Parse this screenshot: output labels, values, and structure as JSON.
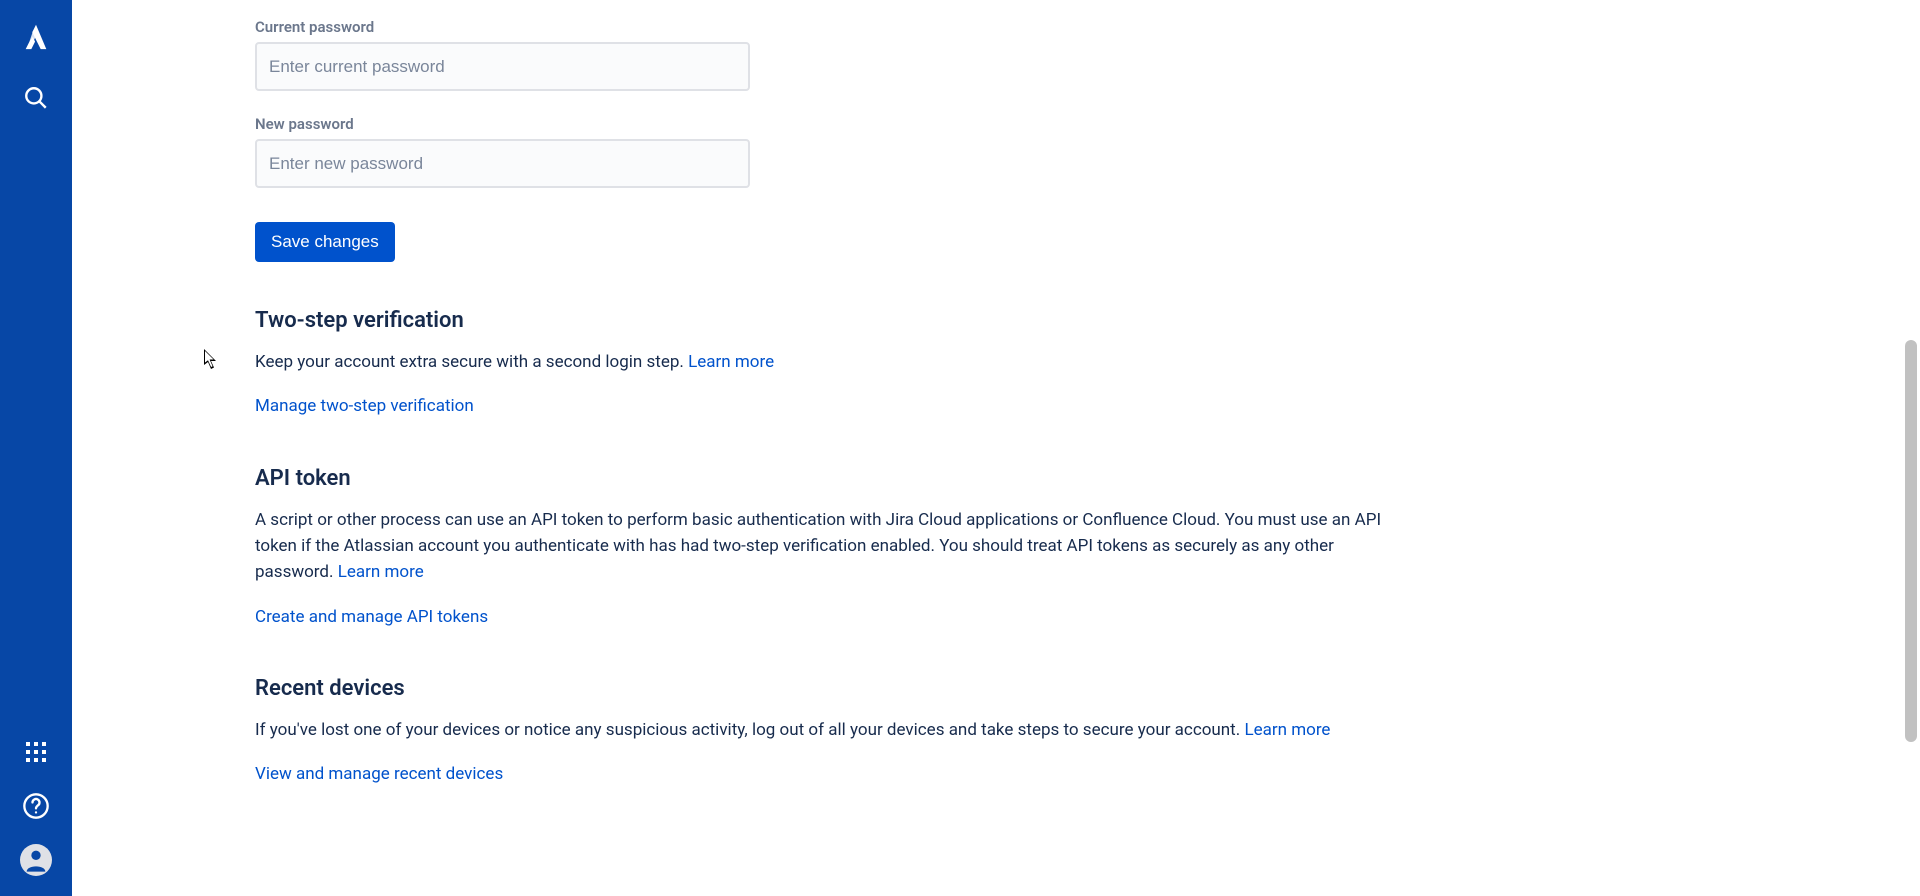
{
  "sidebar": {
    "top": {
      "logo": "atlassian-logo",
      "search": "search-icon"
    },
    "bottom": {
      "apps": "app-switcher-icon",
      "help": "help-icon",
      "profile": "profile-avatar"
    }
  },
  "password": {
    "current_label": "Current password",
    "current_placeholder": "Enter current password",
    "new_label": "New password",
    "new_placeholder": "Enter new password",
    "save_button": "Save changes"
  },
  "twostep": {
    "heading": "Two-step verification",
    "description": "Keep your account extra secure with a second login step. ",
    "learn_more": "Learn more",
    "manage_link": "Manage two-step verification"
  },
  "apitoken": {
    "heading": "API token",
    "description": "A script or other process can use an API token to perform basic authentication with Jira Cloud applications or Confluence Cloud. You must use an API token if the Atlassian account you authenticate with has had two-step verification enabled. You should treat API tokens as securely as any other password. ",
    "learn_more": "Learn more",
    "create_link": "Create and manage API tokens"
  },
  "devices": {
    "heading": "Recent devices",
    "description": "If you've lost one of your devices or notice any suspicious activity, log out of all your devices and take steps to secure your account. ",
    "learn_more": "Learn more",
    "view_link": "View and manage recent devices"
  }
}
